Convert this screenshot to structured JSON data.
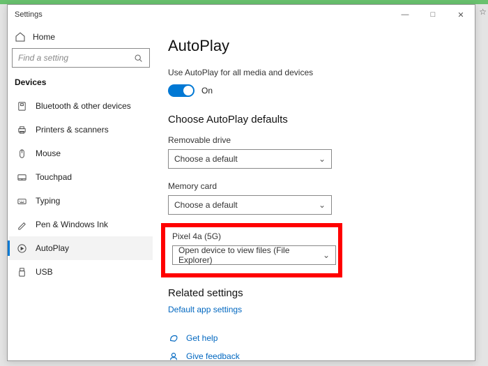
{
  "window": {
    "title": "Settings",
    "min": "—",
    "max": "□",
    "close": "✕"
  },
  "sidebar": {
    "home": "Home",
    "search_placeholder": "Find a setting",
    "section": "Devices",
    "items": [
      {
        "label": "Bluetooth & other devices"
      },
      {
        "label": "Printers & scanners"
      },
      {
        "label": "Mouse"
      },
      {
        "label": "Touchpad"
      },
      {
        "label": "Typing"
      },
      {
        "label": "Pen & Windows Ink"
      },
      {
        "label": "AutoPlay"
      },
      {
        "label": "USB"
      }
    ],
    "selected_index": 6
  },
  "main": {
    "title": "AutoPlay",
    "toggle_caption": "Use AutoPlay for all media and devices",
    "toggle_state": "On",
    "defaults_heading": "Choose AutoPlay defaults",
    "fields": [
      {
        "label": "Removable drive",
        "value": "Choose a default"
      },
      {
        "label": "Memory card",
        "value": "Choose a default"
      },
      {
        "label": "Pixel 4a (5G)",
        "value": "Open device to view files (File Explorer)"
      }
    ],
    "highlight_index": 2,
    "related_heading": "Related settings",
    "related_link": "Default app settings",
    "help_link": "Get help",
    "feedback_link": "Give feedback"
  }
}
